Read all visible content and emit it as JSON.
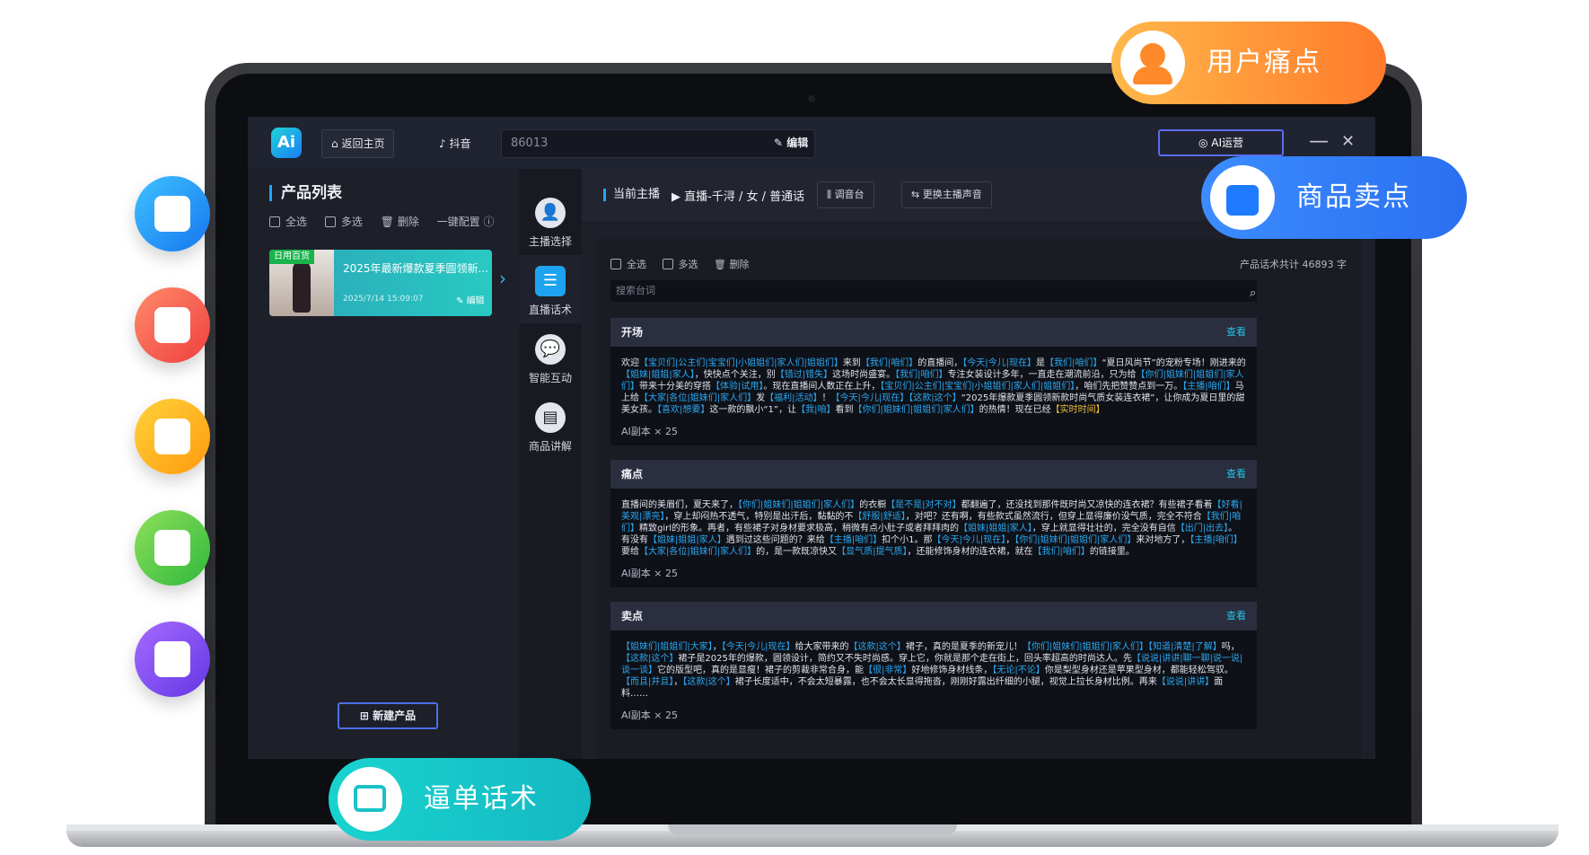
{
  "colors": {
    "accent_blue": "#1ea7ff",
    "teal": "#1fc5e9",
    "screen_bg": "#1b1d24",
    "highlight": "#29a8f2",
    "highlight_yellow": "#f0c23a"
  },
  "badges": {
    "pain_points": "用户痛点",
    "selling_points": "商品卖点",
    "closing_script": "逼单话术"
  },
  "topbar": {
    "home": "返回主页",
    "platform": "抖音",
    "input_value": "86013",
    "edit": "编辑",
    "ai_ops": "AI运营",
    "minimize": "—",
    "close": "✕"
  },
  "left": {
    "title": "产品列表",
    "select_all": "全选",
    "multi": "多选",
    "delete": "删除",
    "one_click": "一键配置",
    "card": {
      "tag": "日用百货",
      "title": "2025年最新爆款夏季圆领新...",
      "date": "2025/7/14 15:09:07",
      "edit": "编辑"
    },
    "new_product": "新建产品"
  },
  "nav": [
    {
      "label": "主播选择",
      "icon": "anchor-icon"
    },
    {
      "label": "直播话术",
      "icon": "script-icon"
    },
    {
      "label": "智能互动",
      "icon": "chat-icon"
    },
    {
      "label": "商品讲解",
      "icon": "explain-icon"
    }
  ],
  "main": {
    "current_anchor": "当前主播",
    "anchor_value": "直播-千浔 / 女 / 普通话",
    "tuning": "调音台",
    "change_voice": "更换主播声音",
    "select_all": "全选",
    "multi": "多选",
    "delete": "删除",
    "count": "产品话术共计 46893 字",
    "search_placeholder": "搜索台词",
    "view": "查看",
    "copies": "AI副本 × 25",
    "sections": [
      {
        "title": "开场"
      },
      {
        "title": "痛点"
      },
      {
        "title": "卖点"
      }
    ]
  }
}
